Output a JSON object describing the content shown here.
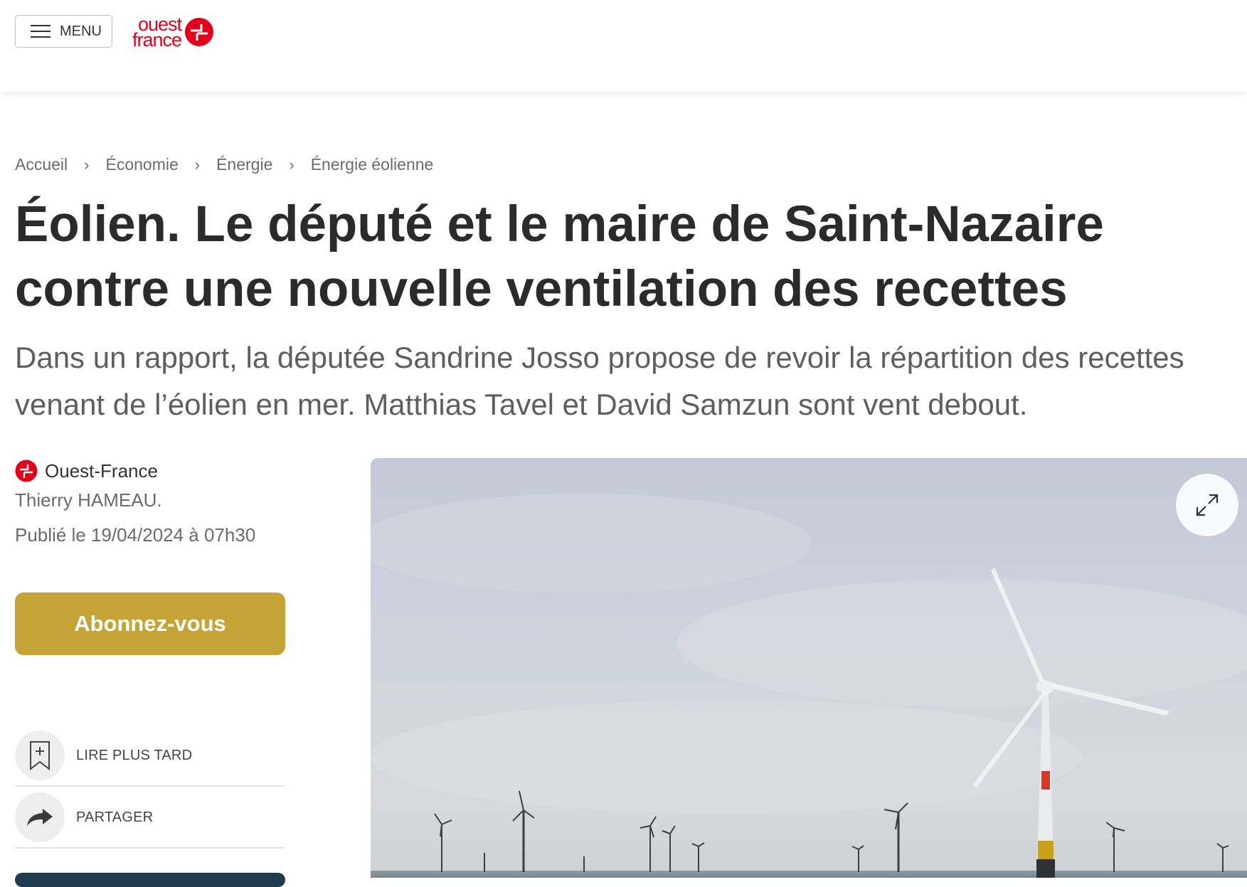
{
  "header": {
    "menu_label": "MENU",
    "logo_line1": "ouest",
    "logo_line2": "france",
    "brand_color": "#e2001a"
  },
  "breadcrumb": {
    "items": [
      "Accueil",
      "Économie",
      "Énergie",
      "Énergie éolienne"
    ],
    "separator": "›"
  },
  "article": {
    "title": "Éolien. Le député et le maire de Saint-Nazaire contre une nouvelle ventilation des recettes",
    "lead": "Dans un rapport, la députée Sandrine Josso propose de revoir la répartition des recettes venant de l’éolien en mer. Matthias Tavel et David Samzun sont vent debout.",
    "source": "Ouest-France",
    "author": "Thierry HAMEAU.",
    "published": "Publié le 19/04/2024 à 07h30"
  },
  "actions": {
    "subscribe": "Abonnez-vous",
    "read_later": "LIRE PLUS TARD",
    "share": "PARTAGER"
  },
  "colors": {
    "subscribe_bg": "#c5a336",
    "text": "#2b2b2b",
    "muted": "#6b6b6b"
  },
  "icons": {
    "menu": "hamburger-icon",
    "read_later": "bookmark-plus-icon",
    "share": "share-arrow-icon",
    "expand": "expand-icon"
  }
}
